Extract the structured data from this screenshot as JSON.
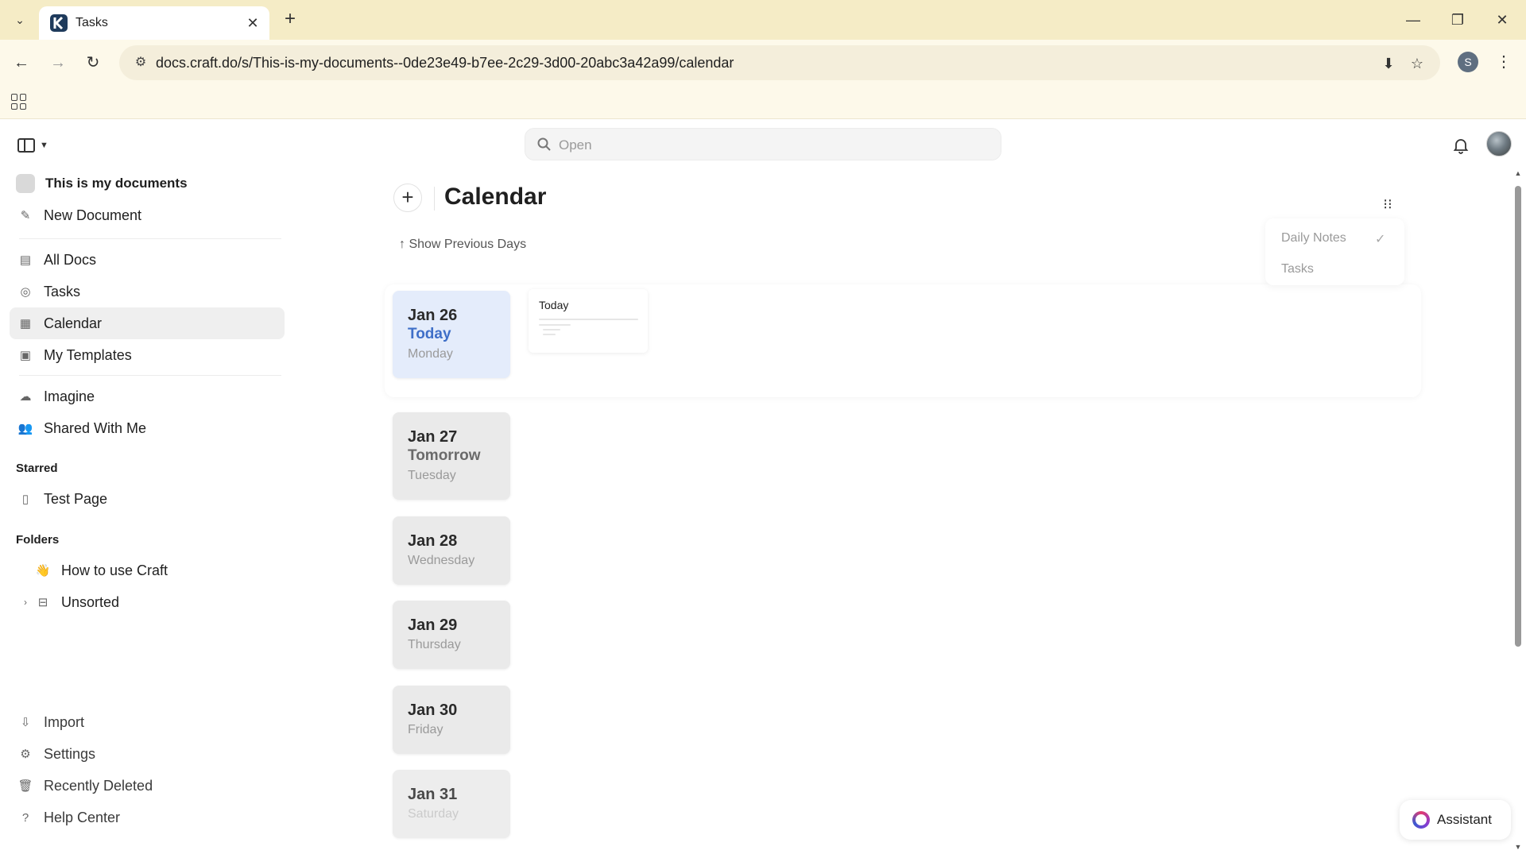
{
  "browser": {
    "tab_title": "Tasks",
    "url": "docs.craft.do/s/This-is-my-documents--0de23e49-b7ee-2c29-3d00-20abc3a42a99/calendar",
    "profile_initial": "S"
  },
  "search": {
    "placeholder": "Open"
  },
  "sidebar": {
    "space_name": "This is my documents",
    "new_document": "New Document",
    "nav": [
      {
        "label": "All Docs",
        "icon": "docs-icon"
      },
      {
        "label": "Tasks",
        "icon": "check-circle-icon"
      },
      {
        "label": "Calendar",
        "icon": "calendar-icon",
        "active": true
      },
      {
        "label": "My Templates",
        "icon": "template-icon"
      }
    ],
    "extras": [
      {
        "label": "Imagine",
        "icon": "cloud-icon"
      },
      {
        "label": "Shared With Me",
        "icon": "people-icon"
      }
    ],
    "starred_heading": "Starred",
    "starred": [
      {
        "label": "Test Page",
        "icon": "page-icon"
      }
    ],
    "folders_heading": "Folders",
    "folders": [
      {
        "label": "How to use Craft",
        "icon": "wave-hand-icon"
      },
      {
        "label": "Unsorted",
        "icon": "inbox-icon"
      }
    ],
    "footer": [
      {
        "label": "Import",
        "icon": "import-icon"
      },
      {
        "label": "Settings",
        "icon": "gear-icon"
      },
      {
        "label": "Recently Deleted",
        "icon": "trash-icon"
      },
      {
        "label": "Help Center",
        "icon": "help-icon"
      }
    ]
  },
  "main": {
    "title": "Calendar",
    "show_previous": "Show Previous Days",
    "menu": {
      "daily_notes": "Daily Notes",
      "tasks": "Tasks",
      "check": "✓"
    },
    "days": [
      {
        "date": "Jan 26",
        "relative": "Today",
        "weekday": "Monday"
      },
      {
        "date": "Jan 27",
        "relative": "Tomorrow",
        "weekday": "Tuesday"
      },
      {
        "date": "Jan 28",
        "relative": "",
        "weekday": "Wednesday"
      },
      {
        "date": "Jan 29",
        "relative": "",
        "weekday": "Thursday"
      },
      {
        "date": "Jan 30",
        "relative": "",
        "weekday": "Friday"
      },
      {
        "date": "Jan 31",
        "relative": "",
        "weekday": "Saturday"
      }
    ],
    "today_note_title": "Today"
  },
  "assistant": {
    "label": "Assistant"
  },
  "colors": {
    "accent_today": "#3f6fc8",
    "browser_frame": "#f5ecc6",
    "today_card_bg": "#e4ecfb"
  }
}
